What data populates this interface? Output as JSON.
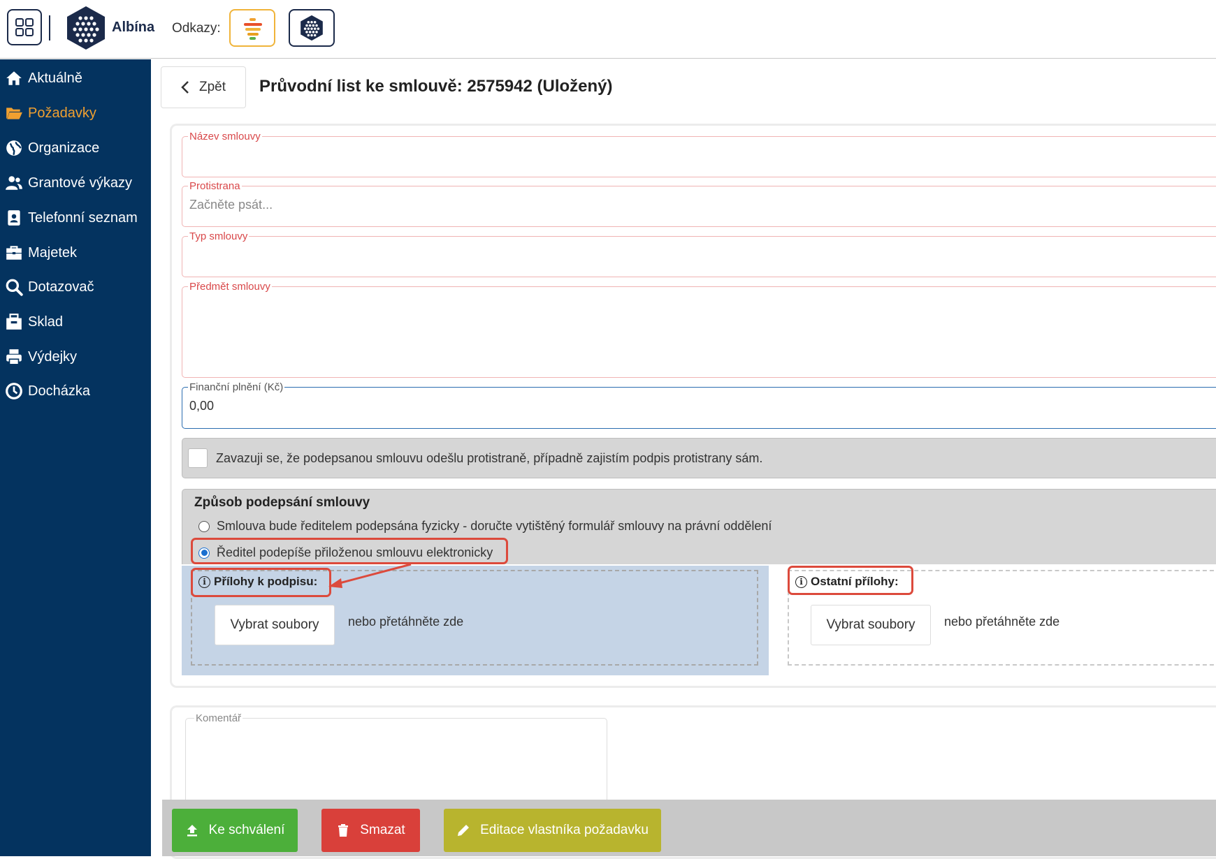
{
  "header": {
    "brand": "Albína",
    "links_label": "Odkazy:"
  },
  "sidebar": {
    "items": [
      {
        "label": "Aktuálně",
        "icon": "home-icon"
      },
      {
        "label": "Požadavky",
        "icon": "folder-open-icon",
        "active": true
      },
      {
        "label": "Organizace",
        "icon": "globe-icon"
      },
      {
        "label": "Grantové výkazy",
        "icon": "users-icon"
      },
      {
        "label": "Telefonní seznam",
        "icon": "id-badge-icon"
      },
      {
        "label": "Majetek",
        "icon": "briefcase-icon"
      },
      {
        "label": "Dotazovač",
        "icon": "search-icon"
      },
      {
        "label": "Sklad",
        "icon": "box-icon"
      },
      {
        "label": "Výdejky",
        "icon": "printer-icon"
      },
      {
        "label": "Docházka",
        "icon": "clock-icon"
      }
    ]
  },
  "main": {
    "back_label": "Zpět",
    "title": "Průvodní list ke smlouvě: 2575942 (Uložený)",
    "fields": {
      "contract_name": {
        "label": "Název smlouvy",
        "value": ""
      },
      "counterparty": {
        "label": "Protistrana",
        "placeholder": "Začněte psát..."
      },
      "contract_type": {
        "label": "Typ smlouvy",
        "value": ""
      },
      "subject": {
        "label": "Předmět smlouvy",
        "value": ""
      },
      "financial": {
        "label": "Finanční plnění (Kč)",
        "value": "0,00"
      }
    },
    "commitment_text": "Zavazuji se, že podepsanou smlouvu odešlu protistraně, případně zajistím podpis protistrany sám.",
    "signing": {
      "title": "Způsob podepsání smlouvy",
      "option_physical": "Smlouva bude ředitelem podepsána fyzicky - doručte vytištěný formulář smlouvy na právní oddělení",
      "option_electronic": "Ředitel podepíše přiloženou smlouvu elektronicky",
      "selected": "electronic"
    },
    "attachments": {
      "sign_label": "Přílohy k podpisu:",
      "other_label": "Ostatní přílohy:",
      "choose_files": "Vybrat soubory",
      "drop_hint": "nebo přetáhněte zde"
    },
    "comment_label": "Komentář"
  },
  "actions": {
    "submit": "Ke schválení",
    "delete": "Smazat",
    "edit_owner": "Editace vlastníka požadavku"
  },
  "colors": {
    "sidebar_bg": "#04335f",
    "active_nav": "#f0a030",
    "highlight": "#dc4a3c",
    "submit_btn": "#4caf3a",
    "delete_btn": "#d9403a",
    "edit_btn": "#b8b42e"
  }
}
